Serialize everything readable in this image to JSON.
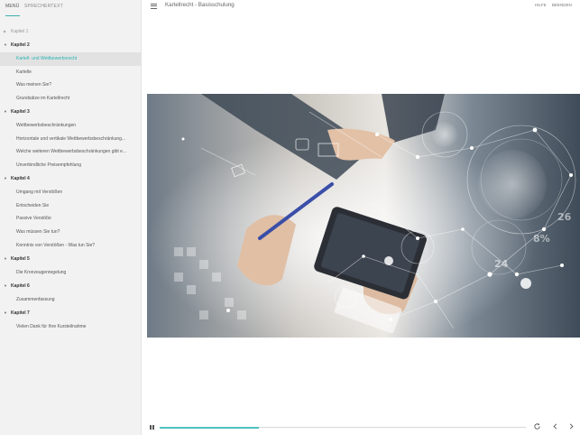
{
  "sidebar": {
    "tabs": [
      {
        "label": "MENÜ",
        "active": true
      },
      {
        "label": "SPRECHERTEXT",
        "active": false
      }
    ],
    "chapters": [
      {
        "label": "Kapitel 1",
        "expanded": false,
        "items": []
      },
      {
        "label": "Kapitel 2",
        "expanded": true,
        "items": [
          {
            "label": "Kartell- und Wettbewerbsrecht",
            "active": true
          },
          {
            "label": "Kartelle"
          },
          {
            "label": "Was meinen Sie?"
          },
          {
            "label": "Grundsätze im Kartellrecht"
          }
        ]
      },
      {
        "label": "Kapitel 3",
        "expanded": true,
        "items": [
          {
            "label": "Wettbewerbsbeschränkungen"
          },
          {
            "label": "Horizontale und vertikale Wettbewerbsbeschränkung..."
          },
          {
            "label": "Welche weiteren Wettbewerbsbeschränkungen gibt e..."
          },
          {
            "label": "Unverbindliche Preisempfehlung"
          }
        ]
      },
      {
        "label": "Kapitel 4",
        "expanded": true,
        "items": [
          {
            "label": "Umgang mit Verstößen"
          },
          {
            "label": "Entscheiden Sie"
          },
          {
            "label": "Passive Verstöße"
          },
          {
            "label": "Was müssen Sie tun?"
          },
          {
            "label": "Kenntnis von Verstößen - Was tun Sie?"
          }
        ]
      },
      {
        "label": "Kapitel 5",
        "expanded": true,
        "items": [
          {
            "label": "Die Kronzeugenregelung"
          }
        ]
      },
      {
        "label": "Kapitel 6",
        "expanded": true,
        "items": [
          {
            "label": "Zusammenfassung"
          }
        ]
      },
      {
        "label": "Kapitel 7",
        "expanded": true,
        "items": [
          {
            "label": "Vielen Dank für Ihre Kursteilnahme"
          }
        ]
      }
    ]
  },
  "header": {
    "title": "Kartellrecht - Basisschulung",
    "help_label": "HILFE",
    "exit_label": "BEENDEN",
    "menu_icon": "hamburger-icon"
  },
  "hero": {
    "icon": "business-technology-photo"
  },
  "player": {
    "progress": 0.27,
    "accent": "#4fc1bf",
    "icons": [
      "pause-icon",
      "replay-icon",
      "previous-icon",
      "next-icon"
    ]
  }
}
